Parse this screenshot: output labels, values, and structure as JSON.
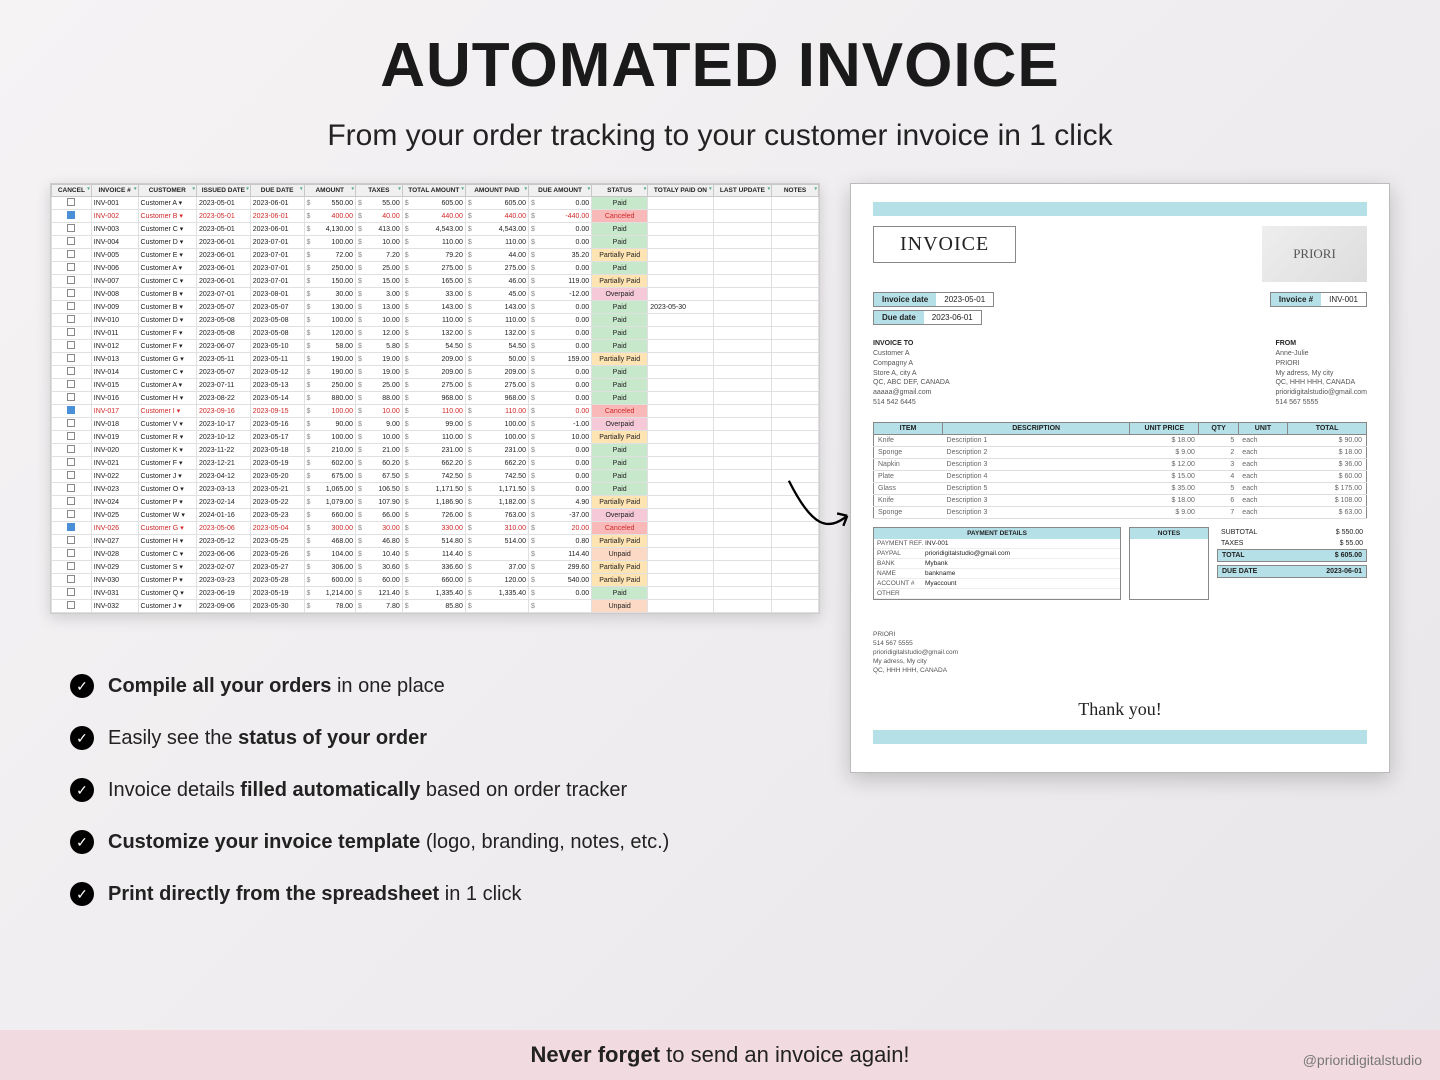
{
  "heading": "AUTOMATED INVOICE",
  "subheading": "From your order tracking to your customer invoice in 1 click",
  "footer_bold": "Never forget",
  "footer_rest": " to send an invoice again!",
  "credit": "@prioridigitalstudio",
  "bullets": [
    {
      "b": "Compile all your orders",
      "r": " in one place"
    },
    {
      "b": "",
      "r": " Easily see the ",
      "b2": "status of your order",
      "r2": ""
    },
    {
      "b": "",
      "r": " Invoice details ",
      "b2": "filled automatically",
      "r2": " based on order tracker"
    },
    {
      "b": "Customize your invoice template",
      "r": " (logo, branding,  notes, etc.)"
    },
    {
      "b": "Print directly from the spreadsheet",
      "r": " in 1 click"
    }
  ],
  "sheet": {
    "headers": [
      "CANCEL",
      "INVOICE #",
      "CUSTOMER",
      "ISSUED DATE",
      "DUE DATE",
      "AMOUNT",
      "TAXES",
      "TOTAL AMOUNT",
      "AMOUNT PAID",
      "DUE AMOUNT",
      "STATUS",
      "TOTALY PAID ON",
      "LAST UPDATE",
      "NOTES"
    ],
    "rows": [
      {
        "chk": false,
        "inv": "INV-001",
        "cust": "Customer A",
        "issued": "2023-05-01",
        "due": "2023-06-01",
        "amt": "550.00",
        "tax": "55.00",
        "tot": "605.00",
        "paid": "605.00",
        "dueamt": "0.00",
        "status": "Paid",
        "paidon": "",
        "upd": "",
        "cls": ""
      },
      {
        "chk": true,
        "inv": "INV-002",
        "cust": "Customer B",
        "issued": "2023-05-01",
        "due": "2023-06-01",
        "amt": "400.00",
        "tax": "40.00",
        "tot": "440.00",
        "paid": "440.00",
        "dueamt": "-440.00",
        "status": "Canceled",
        "paidon": "",
        "upd": "",
        "cls": "cancel"
      },
      {
        "chk": false,
        "inv": "INV-003",
        "cust": "Customer C",
        "issued": "2023-05-01",
        "due": "2023-06-01",
        "amt": "4,130.00",
        "tax": "413.00",
        "tot": "4,543.00",
        "paid": "4,543.00",
        "dueamt": "0.00",
        "status": "Paid",
        "paidon": "",
        "upd": "",
        "cls": ""
      },
      {
        "chk": false,
        "inv": "INV-004",
        "cust": "Customer D",
        "issued": "2023-06-01",
        "due": "2023-07-01",
        "amt": "100.00",
        "tax": "10.00",
        "tot": "110.00",
        "paid": "110.00",
        "dueamt": "0.00",
        "status": "Paid",
        "paidon": "",
        "upd": "",
        "cls": ""
      },
      {
        "chk": false,
        "inv": "INV-005",
        "cust": "Customer E",
        "issued": "2023-06-01",
        "due": "2023-07-01",
        "amt": "72.00",
        "tax": "7.20",
        "tot": "79.20",
        "paid": "44.00",
        "dueamt": "35.20",
        "status": "Partially Paid",
        "paidon": "",
        "upd": "",
        "cls": ""
      },
      {
        "chk": false,
        "inv": "INV-006",
        "cust": "Customer A",
        "issued": "2023-06-01",
        "due": "2023-07-01",
        "amt": "250.00",
        "tax": "25.00",
        "tot": "275.00",
        "paid": "275.00",
        "dueamt": "0.00",
        "status": "Paid",
        "paidon": "",
        "upd": "",
        "cls": ""
      },
      {
        "chk": false,
        "inv": "INV-007",
        "cust": "Customer C",
        "issued": "2023-06-01",
        "due": "2023-07-01",
        "amt": "150.00",
        "tax": "15.00",
        "tot": "165.00",
        "paid": "46.00",
        "dueamt": "119.00",
        "status": "Partially Paid",
        "paidon": "",
        "upd": "",
        "cls": ""
      },
      {
        "chk": false,
        "inv": "INV-008",
        "cust": "Customer B",
        "issued": "2023-07-01",
        "due": "2023-08-01",
        "amt": "30.00",
        "tax": "3.00",
        "tot": "33.00",
        "paid": "45.00",
        "dueamt": "-12.00",
        "status": "Overpaid",
        "paidon": "",
        "upd": "",
        "cls": ""
      },
      {
        "chk": false,
        "inv": "INV-009",
        "cust": "Customer B",
        "issued": "2023-05-07",
        "due": "2023-05-07",
        "amt": "130.00",
        "tax": "13.00",
        "tot": "143.00",
        "paid": "143.00",
        "dueamt": "0.00",
        "status": "Paid",
        "paidon": "2023-05-30",
        "upd": "",
        "cls": ""
      },
      {
        "chk": false,
        "inv": "INV-010",
        "cust": "Customer D",
        "issued": "2023-05-08",
        "due": "2023-05-08",
        "amt": "100.00",
        "tax": "10.00",
        "tot": "110.00",
        "paid": "110.00",
        "dueamt": "0.00",
        "status": "Paid",
        "paidon": "",
        "upd": "",
        "cls": ""
      },
      {
        "chk": false,
        "inv": "INV-011",
        "cust": "Customer F",
        "issued": "2023-05-08",
        "due": "2023-05-08",
        "amt": "120.00",
        "tax": "12.00",
        "tot": "132.00",
        "paid": "132.00",
        "dueamt": "0.00",
        "status": "Paid",
        "paidon": "",
        "upd": "",
        "cls": ""
      },
      {
        "chk": false,
        "inv": "INV-012",
        "cust": "Customer F",
        "issued": "2023-06-07",
        "due": "2023-05-10",
        "amt": "58.00",
        "tax": "5.80",
        "tot": "54.50",
        "paid": "54.50",
        "dueamt": "0.00",
        "status": "Paid",
        "paidon": "",
        "upd": "",
        "cls": ""
      },
      {
        "chk": false,
        "inv": "INV-013",
        "cust": "Customer G",
        "issued": "2023-05-11",
        "due": "2023-05-11",
        "amt": "190.00",
        "tax": "19.00",
        "tot": "209.00",
        "paid": "50.00",
        "dueamt": "159.00",
        "status": "Partially Paid",
        "paidon": "",
        "upd": "",
        "cls": ""
      },
      {
        "chk": false,
        "inv": "INV-014",
        "cust": "Customer C",
        "issued": "2023-05-07",
        "due": "2023-05-12",
        "amt": "190.00",
        "tax": "19.00",
        "tot": "209.00",
        "paid": "209.00",
        "dueamt": "0.00",
        "status": "Paid",
        "paidon": "",
        "upd": "",
        "cls": ""
      },
      {
        "chk": false,
        "inv": "INV-015",
        "cust": "Customer A",
        "issued": "2023-07-11",
        "due": "2023-05-13",
        "amt": "250.00",
        "tax": "25.00",
        "tot": "275.00",
        "paid": "275.00",
        "dueamt": "0.00",
        "status": "Paid",
        "paidon": "",
        "upd": "",
        "cls": ""
      },
      {
        "chk": false,
        "inv": "INV-016",
        "cust": "Customer H",
        "issued": "2023-08-22",
        "due": "2023-05-14",
        "amt": "880.00",
        "tax": "88.00",
        "tot": "968.00",
        "paid": "968.00",
        "dueamt": "0.00",
        "status": "Paid",
        "paidon": "",
        "upd": "",
        "cls": ""
      },
      {
        "chk": true,
        "inv": "INV-017",
        "cust": "Customer I",
        "issued": "2023-09-16",
        "due": "2023-09-15",
        "amt": "100.00",
        "tax": "10.00",
        "tot": "110.00",
        "paid": "110.00",
        "dueamt": "0.00",
        "status": "Canceled",
        "paidon": "",
        "upd": "",
        "cls": "cancel"
      },
      {
        "chk": false,
        "inv": "INV-018",
        "cust": "Customer V",
        "issued": "2023-10-17",
        "due": "2023-05-16",
        "amt": "90.00",
        "tax": "9.00",
        "tot": "99.00",
        "paid": "100.00",
        "dueamt": "-1.00",
        "status": "Overpaid",
        "paidon": "",
        "upd": "",
        "cls": ""
      },
      {
        "chk": false,
        "inv": "INV-019",
        "cust": "Customer R",
        "issued": "2023-10-12",
        "due": "2023-05-17",
        "amt": "100.00",
        "tax": "10.00",
        "tot": "110.00",
        "paid": "100.00",
        "dueamt": "10.00",
        "status": "Partially Paid",
        "paidon": "",
        "upd": "",
        "cls": ""
      },
      {
        "chk": false,
        "inv": "INV-020",
        "cust": "Customer K",
        "issued": "2023-11-22",
        "due": "2023-05-18",
        "amt": "210.00",
        "tax": "21.00",
        "tot": "231.00",
        "paid": "231.00",
        "dueamt": "0.00",
        "status": "Paid",
        "paidon": "",
        "upd": "",
        "cls": ""
      },
      {
        "chk": false,
        "inv": "INV-021",
        "cust": "Customer F",
        "issued": "2023-12-21",
        "due": "2023-05-19",
        "amt": "602.00",
        "tax": "60.20",
        "tot": "662.20",
        "paid": "662.20",
        "dueamt": "0.00",
        "status": "Paid",
        "paidon": "",
        "upd": "",
        "cls": ""
      },
      {
        "chk": false,
        "inv": "INV-022",
        "cust": "Customer J",
        "issued": "2023-04-12",
        "due": "2023-05-20",
        "amt": "675.00",
        "tax": "67.50",
        "tot": "742.50",
        "paid": "742.50",
        "dueamt": "0.00",
        "status": "Paid",
        "paidon": "",
        "upd": "",
        "cls": ""
      },
      {
        "chk": false,
        "inv": "INV-023",
        "cust": "Customer O",
        "issued": "2023-03-13",
        "due": "2023-05-21",
        "amt": "1,065.00",
        "tax": "106.50",
        "tot": "1,171.50",
        "paid": "1,171.50",
        "dueamt": "0.00",
        "status": "Paid",
        "paidon": "",
        "upd": "",
        "cls": ""
      },
      {
        "chk": false,
        "inv": "INV-024",
        "cust": "Customer P",
        "issued": "2023-02-14",
        "due": "2023-05-22",
        "amt": "1,079.00",
        "tax": "107.90",
        "tot": "1,186.90",
        "paid": "1,182.00",
        "dueamt": "4.90",
        "status": "Partially Paid",
        "paidon": "",
        "upd": "",
        "cls": ""
      },
      {
        "chk": false,
        "inv": "INV-025",
        "cust": "Customer W",
        "issued": "2024-01-16",
        "due": "2023-05-23",
        "amt": "660.00",
        "tax": "66.00",
        "tot": "726.00",
        "paid": "763.00",
        "dueamt": "-37.00",
        "status": "Overpaid",
        "paidon": "",
        "upd": "",
        "cls": ""
      },
      {
        "chk": true,
        "inv": "INV-026",
        "cust": "Customer G",
        "issued": "2023-05-06",
        "due": "2023-05-04",
        "amt": "300.00",
        "tax": "30.00",
        "tot": "330.00",
        "paid": "310.00",
        "dueamt": "20.00",
        "status": "Canceled",
        "paidon": "",
        "upd": "",
        "cls": "cancel"
      },
      {
        "chk": false,
        "inv": "INV-027",
        "cust": "Customer H",
        "issued": "2023-05-12",
        "due": "2023-05-25",
        "amt": "468.00",
        "tax": "46.80",
        "tot": "514.80",
        "paid": "514.00",
        "dueamt": "0.80",
        "status": "Partially Paid",
        "paidon": "",
        "upd": "",
        "cls": ""
      },
      {
        "chk": false,
        "inv": "INV-028",
        "cust": "Customer C",
        "issued": "2023-06-06",
        "due": "2023-05-26",
        "amt": "104.00",
        "tax": "10.40",
        "tot": "114.40",
        "paid": "",
        "dueamt": "114.40",
        "status": "Unpaid",
        "paidon": "",
        "upd": "",
        "cls": ""
      },
      {
        "chk": false,
        "inv": "INV-029",
        "cust": "Customer S",
        "issued": "2023-02-07",
        "due": "2023-05-27",
        "amt": "306.00",
        "tax": "30.60",
        "tot": "336.60",
        "paid": "37.00",
        "dueamt": "299.60",
        "status": "Partially Paid",
        "paidon": "",
        "upd": "",
        "cls": ""
      },
      {
        "chk": false,
        "inv": "INV-030",
        "cust": "Customer P",
        "issued": "2023-03-23",
        "due": "2023-05-28",
        "amt": "600.00",
        "tax": "60.00",
        "tot": "660.00",
        "paid": "120.00",
        "dueamt": "540.00",
        "status": "Partially Paid",
        "paidon": "",
        "upd": "",
        "cls": ""
      },
      {
        "chk": false,
        "inv": "INV-031",
        "cust": "Customer Q",
        "issued": "2023-06-19",
        "due": "2023-05-19",
        "amt": "1,214.00",
        "tax": "121.40",
        "tot": "1,335.40",
        "paid": "1,335.40",
        "dueamt": "0.00",
        "status": "Paid",
        "paidon": "",
        "upd": "",
        "cls": ""
      },
      {
        "chk": false,
        "inv": "INV-032",
        "cust": "Customer J",
        "issued": "2023-09-06",
        "due": "2023-05-30",
        "amt": "78.00",
        "tax": "7.80",
        "tot": "85.80",
        "paid": "",
        "dueamt": "",
        "status": "Unpaid",
        "paidon": "",
        "upd": "",
        "cls": ""
      }
    ]
  },
  "invoice": {
    "title": "INVOICE",
    "logo": "PRIORI",
    "inv_date_lab": "Invoice date",
    "inv_date": "2023-05-01",
    "due_date_lab": "Due date",
    "due_date": "2023-06-01",
    "num_lab": "Invoice #",
    "num": "INV-001",
    "to_h": "INVOICE TO",
    "to": [
      "Customer A",
      "Compagny A",
      "Store A, city A",
      "QC, ABC DEF, CANADA",
      "aaaaa@gmail.com",
      "514 542 6445"
    ],
    "from_h": "FROM",
    "from": [
      "Anne-Julie",
      "PRIORI",
      "My adress, My city",
      "QC, HHH HHH, CANADA",
      "prioridigitalstudio@gmail.com",
      "514 567 5555"
    ],
    "item_h": [
      "ITEM",
      "DESCRIPTION",
      "UNIT PRICE",
      "QTY",
      "UNIT",
      "TOTAL"
    ],
    "items": [
      [
        "Knife",
        "Description 1",
        "18.00",
        "5",
        "each",
        "90.00"
      ],
      [
        "Sponge",
        "Description 2",
        "9.00",
        "2",
        "each",
        "18.00"
      ],
      [
        "Napkin",
        "Description 3",
        "12.00",
        "3",
        "each",
        "36.00"
      ],
      [
        "Plate",
        "Description 4",
        "15.00",
        "4",
        "each",
        "60.00"
      ],
      [
        "Glass",
        "Description 5",
        "35.00",
        "5",
        "each",
        "175.00"
      ],
      [
        "Knife",
        "Description 3",
        "18.00",
        "6",
        "each",
        "108.00"
      ],
      [
        "Sponge",
        "Description 3",
        "9.00",
        "7",
        "each",
        "63.00"
      ]
    ],
    "pay_h": "PAYMENT DETAILS",
    "pay": [
      [
        "PAYMENT REF.",
        "INV-001"
      ],
      [
        "PAYPAL",
        "prioridigitalstudio@gmail.com"
      ],
      [
        "BANK",
        "Mybank"
      ],
      [
        "NAME",
        "bankname"
      ],
      [
        "ACCOUNT #",
        "Myaccount"
      ],
      [
        "OTHER",
        ""
      ]
    ],
    "notes_h": "NOTES",
    "subtotal_lab": "SUBTOTAL",
    "subtotal": "550.00",
    "taxes_lab": "TAXES",
    "taxes": "55.00",
    "total_lab": "TOTAL",
    "total": "605.00",
    "duelab": "DUE DATE",
    "duedate": "2023-06-01",
    "foot": [
      "PRIORI",
      "514 567 5555",
      "prioridigitalstudio@gmail.com",
      "My adress, My city",
      "QC, HHH HHH, CANADA"
    ],
    "thank": "Thank you!"
  }
}
